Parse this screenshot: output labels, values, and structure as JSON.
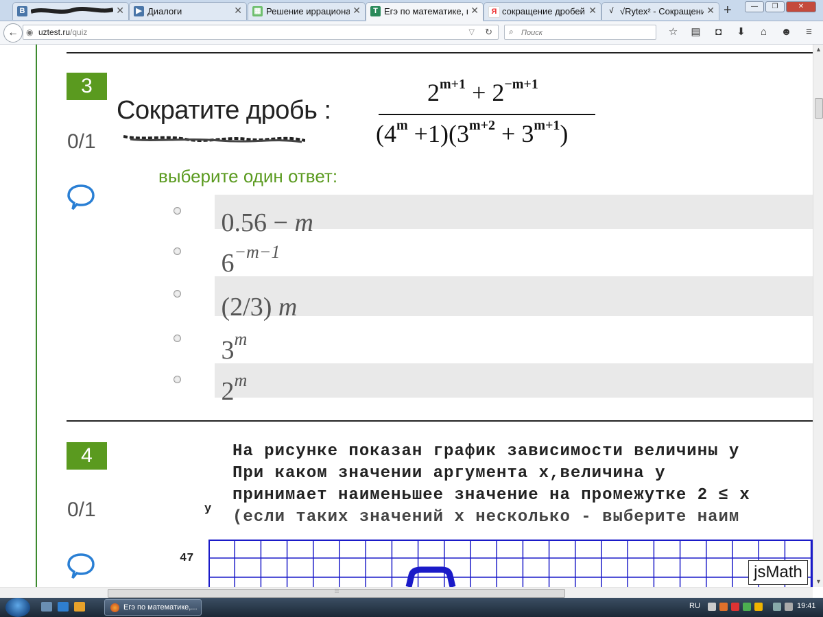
{
  "browser": {
    "tabs": [
      {
        "label": "",
        "favicon": "vk-icon",
        "color": "#4a76a8",
        "glyph": "B"
      },
      {
        "label": "Диалоги",
        "favicon": "vk-icon",
        "color": "#4a76a8",
        "glyph": "▶"
      },
      {
        "label": "Решение иррациона...",
        "favicon": "site-icon",
        "color": "#6fbf6f",
        "glyph": "▦"
      },
      {
        "label": "Егэ по математике, п...",
        "favicon": "uztest-icon",
        "color": "#2a8a5a",
        "glyph": "T"
      },
      {
        "label": "сокращение дробей ...",
        "favicon": "yandex-icon",
        "color": "#e33",
        "glyph": "Я"
      },
      {
        "label": "√Rytex² - Сокращени...",
        "favicon": "sqrt-icon",
        "color": "#555",
        "glyph": "√"
      }
    ],
    "active_tab": 3,
    "new_tab": "+",
    "url_host": "uztest.ru",
    "url_path": "/quiz",
    "search_placeholder": "Поиск"
  },
  "q3": {
    "number": "3",
    "score": "0/1",
    "title": "Сократите дробь :",
    "fraction": {
      "num_base1": "2",
      "num_exp1": "m+1",
      "num_op": " + ",
      "num_base2": "2",
      "num_exp2": "−m+1",
      "den_open": "(4",
      "den_exp1": "m",
      "den_mid": " +1)(3",
      "den_exp2": "m+2",
      "den_plus": " + 3",
      "den_exp3": "m+1",
      "den_close": ")"
    },
    "prompt": "выберите один ответ:",
    "options": [
      {
        "base": "0.56 − ",
        "var": "m",
        "exp": ""
      },
      {
        "base": "6",
        "var": "",
        "exp": "−m−1"
      },
      {
        "base": "(2/3) ",
        "var": "m",
        "exp": ""
      },
      {
        "base": "3",
        "var": "",
        "exp": "m"
      },
      {
        "base": "2",
        "var": "",
        "exp": "m"
      }
    ]
  },
  "q4": {
    "number": "4",
    "score": "0/1",
    "lines": [
      "На рисунке показан график зависимости величины y",
      "При каком значении аргумента x,величина y",
      "принимает наименьшее значение на промежутке 2 ≤ x",
      "(если таких значений x несколько - выберите наим"
    ],
    "axis_label": "y",
    "tick_label": "47"
  },
  "jsmath_label": "jsMath",
  "taskbar": {
    "task_label": "Егэ по математике,...",
    "language": "RU",
    "time": "19:41"
  },
  "colors": {
    "accent_green": "#5a9a1f",
    "grid_blue": "#1a1ac8"
  }
}
